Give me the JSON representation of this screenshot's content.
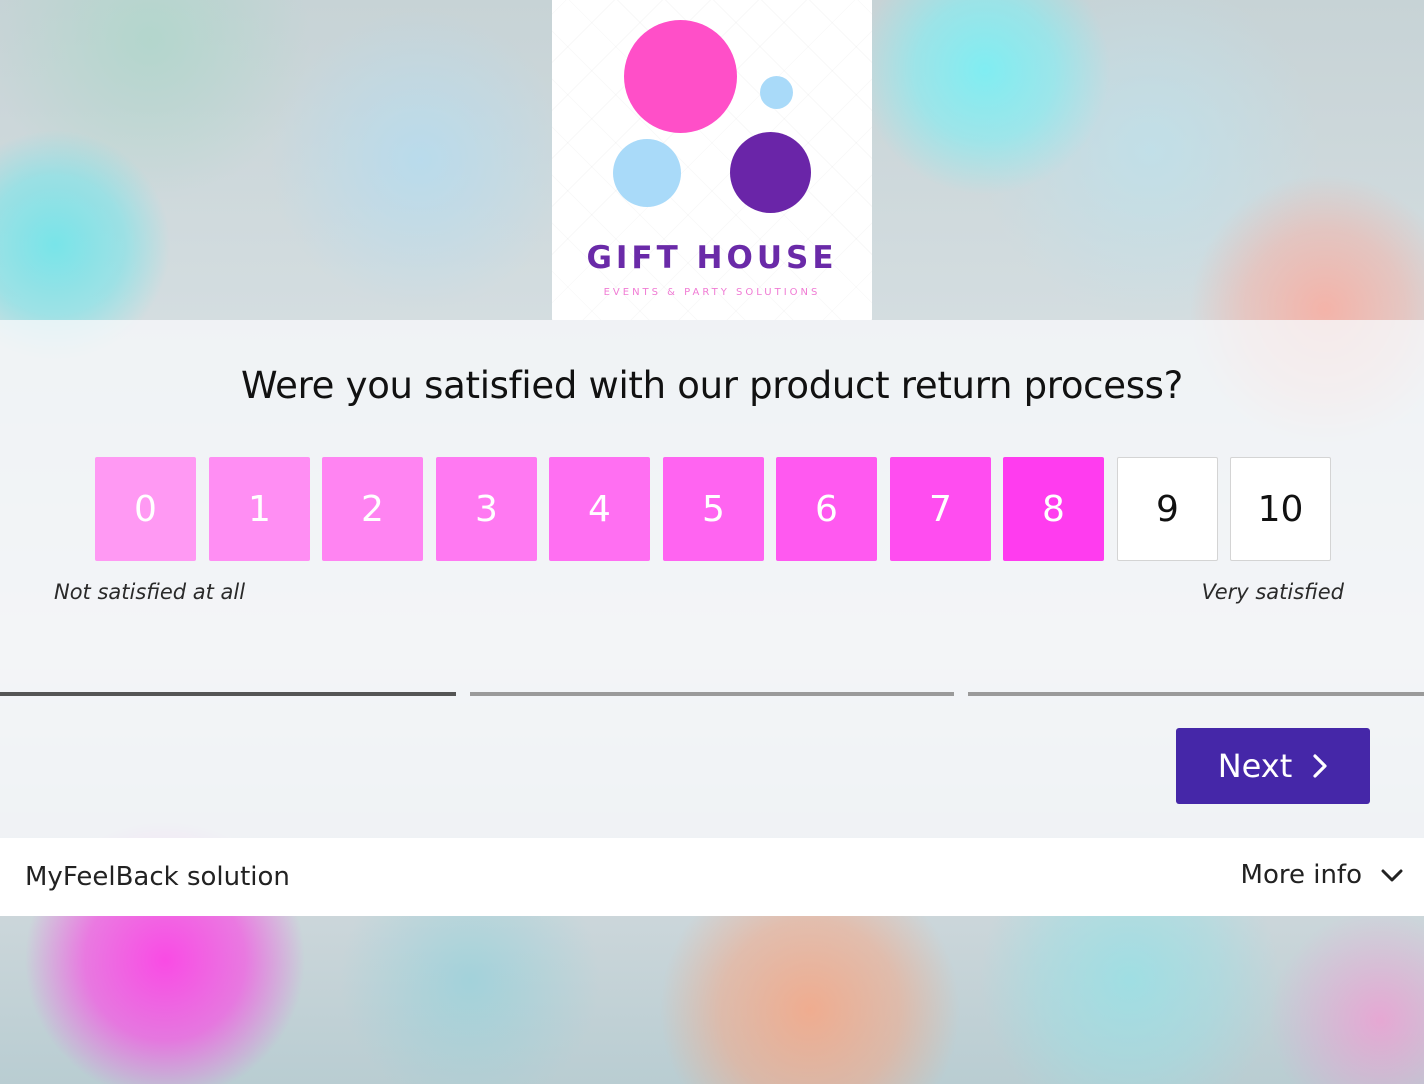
{
  "logo": {
    "title": "GIFT HOUSE",
    "tagline": "EVENTS & PARTY SOLUTIONS"
  },
  "survey": {
    "question": "Were you satisfied with our product return process?",
    "scale": [
      {
        "label": "0",
        "color": "#ff99f3"
      },
      {
        "label": "1",
        "color": "#ff8ef3"
      },
      {
        "label": "2",
        "color": "#ff84f2"
      },
      {
        "label": "3",
        "color": "#ff79f2"
      },
      {
        "label": "4",
        "color": "#ff6ff2"
      },
      {
        "label": "5",
        "color": "#ff64f1"
      },
      {
        "label": "6",
        "color": "#ff59f0"
      },
      {
        "label": "7",
        "color": "#ff4df0"
      },
      {
        "label": "8",
        "color": "#ff3cef"
      },
      {
        "label": "9",
        "color": "#ffffff"
      },
      {
        "label": "10",
        "color": "#ffffff"
      }
    ],
    "low_label": "Not satisfied at all",
    "high_label": "Very satisfied",
    "progress": {
      "current_step": 1,
      "total_steps": 3
    },
    "next_label": "Next",
    "next_icon": "chevron-right-icon",
    "accent_color": "#4527a8"
  },
  "footer": {
    "brand": "MyFeelBack solution",
    "more_info_label": "More info",
    "more_info_icon": "chevron-down-icon"
  }
}
